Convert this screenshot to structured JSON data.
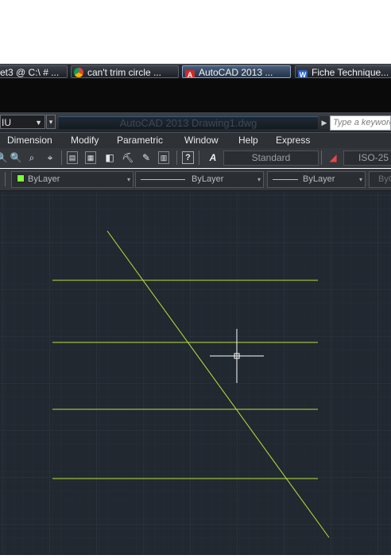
{
  "taskbar": {
    "tasks": [
      {
        "label": "et3 @ C:\\  # ...",
        "icon": "terminal-icon"
      },
      {
        "label": "can't trim circle ...",
        "icon": "chrome-icon"
      },
      {
        "label": "AutoCAD 2013 ...",
        "icon": "autocad-icon"
      },
      {
        "label": "Fiche Technique...",
        "icon": "word-icon"
      }
    ]
  },
  "titlebar": {
    "workspace_value": "IU",
    "doc_title": "AutoCAD 2013   Drawing1.dwg",
    "search_placeholder": "Type a keyword"
  },
  "menubar": {
    "items": [
      "Dimension",
      "Modify",
      "Parametric",
      "Window",
      "Help",
      "Express"
    ]
  },
  "toolbar1": {
    "text_style": "Standard",
    "dim_style": "ISO-25"
  },
  "toolbar2": {
    "color": "ByLayer",
    "linetype": "ByLayer",
    "lineweight": "ByLayer",
    "plotstyle": "ByC",
    "color_swatch": "#7cff3c"
  },
  "drawing": {
    "background": "#212830",
    "grid_color": "#2c3540",
    "line_color": "#b7e43a",
    "crosshair_color": "#ffffff"
  }
}
